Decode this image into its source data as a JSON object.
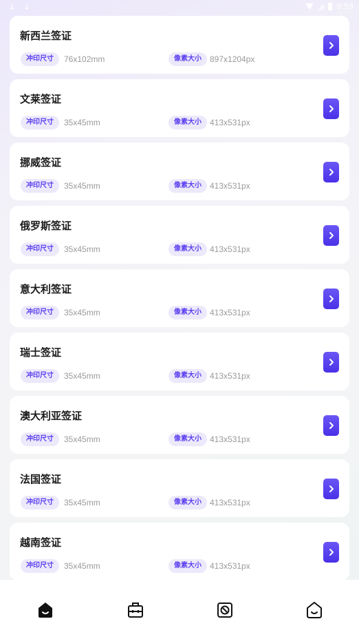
{
  "status_bar": {
    "download_glyph_1": "↓",
    "download_glyph_2": "↓",
    "time": "0:59"
  },
  "tags": {
    "print_label": "冲印尺寸",
    "pixel_label": "像素大小"
  },
  "visas": [
    {
      "title": "新西兰签证",
      "print_size": "76x102mm",
      "pixel_size": "897x1204px"
    },
    {
      "title": "文莱签证",
      "print_size": "35x45mm",
      "pixel_size": "413x531px"
    },
    {
      "title": "挪威签证",
      "print_size": "35x45mm",
      "pixel_size": "413x531px"
    },
    {
      "title": "俄罗斯签证",
      "print_size": "35x45mm",
      "pixel_size": "413x531px"
    },
    {
      "title": "意大利签证",
      "print_size": "35x45mm",
      "pixel_size": "413x531px"
    },
    {
      "title": "瑞士签证",
      "print_size": "35x45mm",
      "pixel_size": "413x531px"
    },
    {
      "title": "澳大利亚签证",
      "print_size": "35x45mm",
      "pixel_size": "413x531px"
    },
    {
      "title": "法国签证",
      "print_size": "35x45mm",
      "pixel_size": "413x531px"
    },
    {
      "title": "越南签证",
      "print_size": "35x45mm",
      "pixel_size": "413x531px"
    }
  ],
  "tabbar": {
    "items": [
      {
        "icon": "home-icon",
        "active": true
      },
      {
        "icon": "toolbox-icon",
        "active": false
      },
      {
        "icon": "camera-icon",
        "active": false
      },
      {
        "icon": "profile-icon",
        "active": false
      }
    ]
  },
  "colors": {
    "accent": "#5b3ff0",
    "tag_bg": "#ece9fb",
    "card_bg": "#ffffff"
  }
}
